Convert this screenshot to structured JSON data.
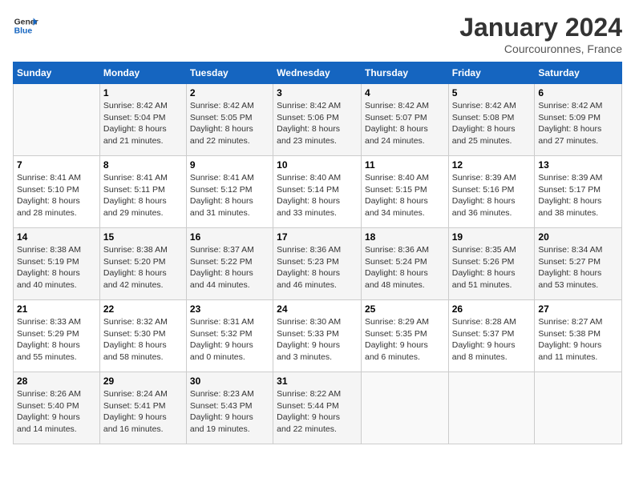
{
  "logo": {
    "text_general": "General",
    "text_blue": "Blue"
  },
  "title": "January 2024",
  "location": "Courcouronnes, France",
  "days_header": [
    "Sunday",
    "Monday",
    "Tuesday",
    "Wednesday",
    "Thursday",
    "Friday",
    "Saturday"
  ],
  "weeks": [
    [
      {
        "day": "",
        "info": ""
      },
      {
        "day": "1",
        "info": "Sunrise: 8:42 AM\nSunset: 5:04 PM\nDaylight: 8 hours\nand 21 minutes."
      },
      {
        "day": "2",
        "info": "Sunrise: 8:42 AM\nSunset: 5:05 PM\nDaylight: 8 hours\nand 22 minutes."
      },
      {
        "day": "3",
        "info": "Sunrise: 8:42 AM\nSunset: 5:06 PM\nDaylight: 8 hours\nand 23 minutes."
      },
      {
        "day": "4",
        "info": "Sunrise: 8:42 AM\nSunset: 5:07 PM\nDaylight: 8 hours\nand 24 minutes."
      },
      {
        "day": "5",
        "info": "Sunrise: 8:42 AM\nSunset: 5:08 PM\nDaylight: 8 hours\nand 25 minutes."
      },
      {
        "day": "6",
        "info": "Sunrise: 8:42 AM\nSunset: 5:09 PM\nDaylight: 8 hours\nand 27 minutes."
      }
    ],
    [
      {
        "day": "7",
        "info": "Sunrise: 8:41 AM\nSunset: 5:10 PM\nDaylight: 8 hours\nand 28 minutes."
      },
      {
        "day": "8",
        "info": "Sunrise: 8:41 AM\nSunset: 5:11 PM\nDaylight: 8 hours\nand 29 minutes."
      },
      {
        "day": "9",
        "info": "Sunrise: 8:41 AM\nSunset: 5:12 PM\nDaylight: 8 hours\nand 31 minutes."
      },
      {
        "day": "10",
        "info": "Sunrise: 8:40 AM\nSunset: 5:14 PM\nDaylight: 8 hours\nand 33 minutes."
      },
      {
        "day": "11",
        "info": "Sunrise: 8:40 AM\nSunset: 5:15 PM\nDaylight: 8 hours\nand 34 minutes."
      },
      {
        "day": "12",
        "info": "Sunrise: 8:39 AM\nSunset: 5:16 PM\nDaylight: 8 hours\nand 36 minutes."
      },
      {
        "day": "13",
        "info": "Sunrise: 8:39 AM\nSunset: 5:17 PM\nDaylight: 8 hours\nand 38 minutes."
      }
    ],
    [
      {
        "day": "14",
        "info": "Sunrise: 8:38 AM\nSunset: 5:19 PM\nDaylight: 8 hours\nand 40 minutes."
      },
      {
        "day": "15",
        "info": "Sunrise: 8:38 AM\nSunset: 5:20 PM\nDaylight: 8 hours\nand 42 minutes."
      },
      {
        "day": "16",
        "info": "Sunrise: 8:37 AM\nSunset: 5:22 PM\nDaylight: 8 hours\nand 44 minutes."
      },
      {
        "day": "17",
        "info": "Sunrise: 8:36 AM\nSunset: 5:23 PM\nDaylight: 8 hours\nand 46 minutes."
      },
      {
        "day": "18",
        "info": "Sunrise: 8:36 AM\nSunset: 5:24 PM\nDaylight: 8 hours\nand 48 minutes."
      },
      {
        "day": "19",
        "info": "Sunrise: 8:35 AM\nSunset: 5:26 PM\nDaylight: 8 hours\nand 51 minutes."
      },
      {
        "day": "20",
        "info": "Sunrise: 8:34 AM\nSunset: 5:27 PM\nDaylight: 8 hours\nand 53 minutes."
      }
    ],
    [
      {
        "day": "21",
        "info": "Sunrise: 8:33 AM\nSunset: 5:29 PM\nDaylight: 8 hours\nand 55 minutes."
      },
      {
        "day": "22",
        "info": "Sunrise: 8:32 AM\nSunset: 5:30 PM\nDaylight: 8 hours\nand 58 minutes."
      },
      {
        "day": "23",
        "info": "Sunrise: 8:31 AM\nSunset: 5:32 PM\nDaylight: 9 hours\nand 0 minutes."
      },
      {
        "day": "24",
        "info": "Sunrise: 8:30 AM\nSunset: 5:33 PM\nDaylight: 9 hours\nand 3 minutes."
      },
      {
        "day": "25",
        "info": "Sunrise: 8:29 AM\nSunset: 5:35 PM\nDaylight: 9 hours\nand 6 minutes."
      },
      {
        "day": "26",
        "info": "Sunrise: 8:28 AM\nSunset: 5:37 PM\nDaylight: 9 hours\nand 8 minutes."
      },
      {
        "day": "27",
        "info": "Sunrise: 8:27 AM\nSunset: 5:38 PM\nDaylight: 9 hours\nand 11 minutes."
      }
    ],
    [
      {
        "day": "28",
        "info": "Sunrise: 8:26 AM\nSunset: 5:40 PM\nDaylight: 9 hours\nand 14 minutes."
      },
      {
        "day": "29",
        "info": "Sunrise: 8:24 AM\nSunset: 5:41 PM\nDaylight: 9 hours\nand 16 minutes."
      },
      {
        "day": "30",
        "info": "Sunrise: 8:23 AM\nSunset: 5:43 PM\nDaylight: 9 hours\nand 19 minutes."
      },
      {
        "day": "31",
        "info": "Sunrise: 8:22 AM\nSunset: 5:44 PM\nDaylight: 9 hours\nand 22 minutes."
      },
      {
        "day": "",
        "info": ""
      },
      {
        "day": "",
        "info": ""
      },
      {
        "day": "",
        "info": ""
      }
    ]
  ]
}
